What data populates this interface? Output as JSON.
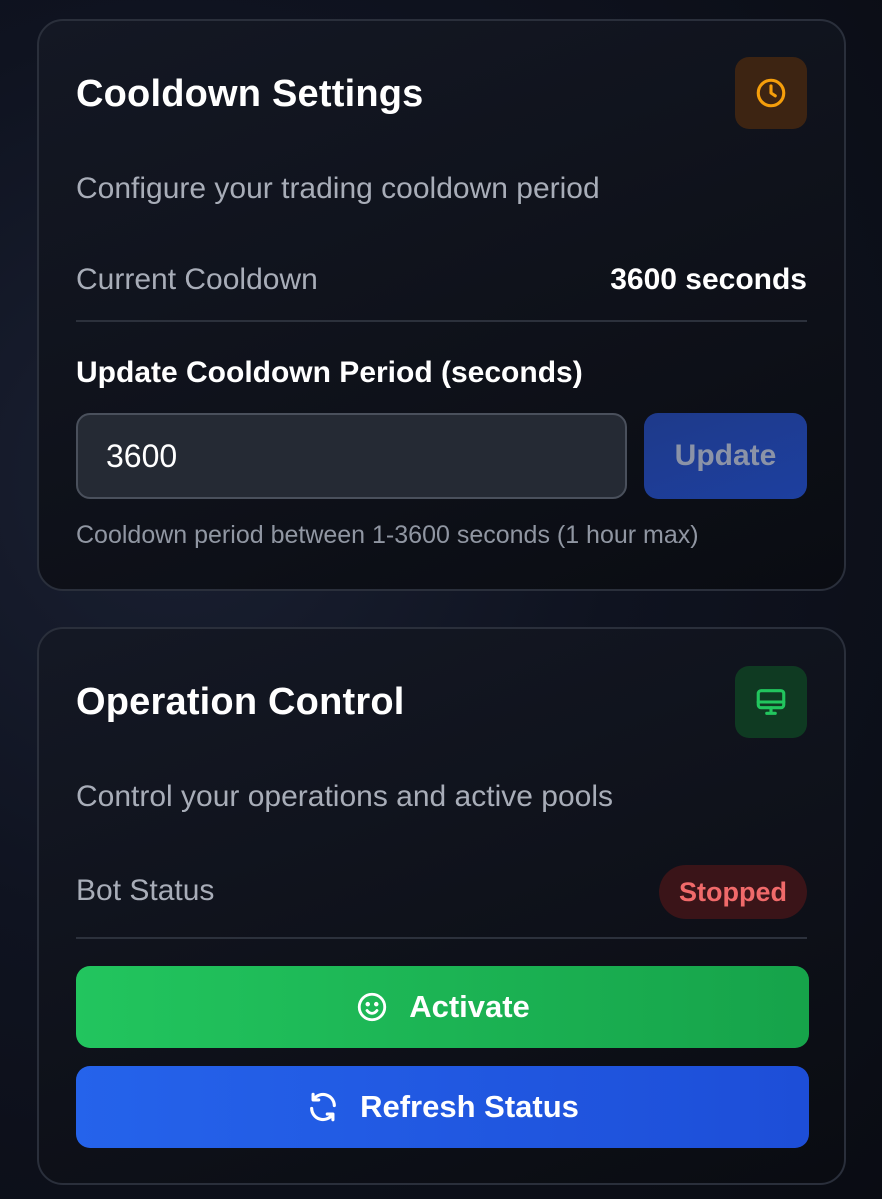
{
  "cooldown": {
    "title": "Cooldown Settings",
    "icon": "clock-icon",
    "description": "Configure your trading cooldown period",
    "current_label": "Current Cooldown",
    "current_value": "3600 seconds",
    "update_label": "Update Cooldown Period (seconds)",
    "input_value": "3600",
    "update_button": "Update",
    "hint": "Cooldown period between 1-3600 seconds (1 hour max)",
    "accent_color": "#f59e0b"
  },
  "operation": {
    "title": "Operation Control",
    "icon": "monitor-icon",
    "description": "Control your operations and active pools",
    "status_label": "Bot Status",
    "status_value": "Stopped",
    "activate_button": "Activate",
    "activate_icon": "smile-icon",
    "refresh_button": "Refresh Status",
    "refresh_icon": "refresh-icon",
    "accent_color": "#22c55e"
  }
}
